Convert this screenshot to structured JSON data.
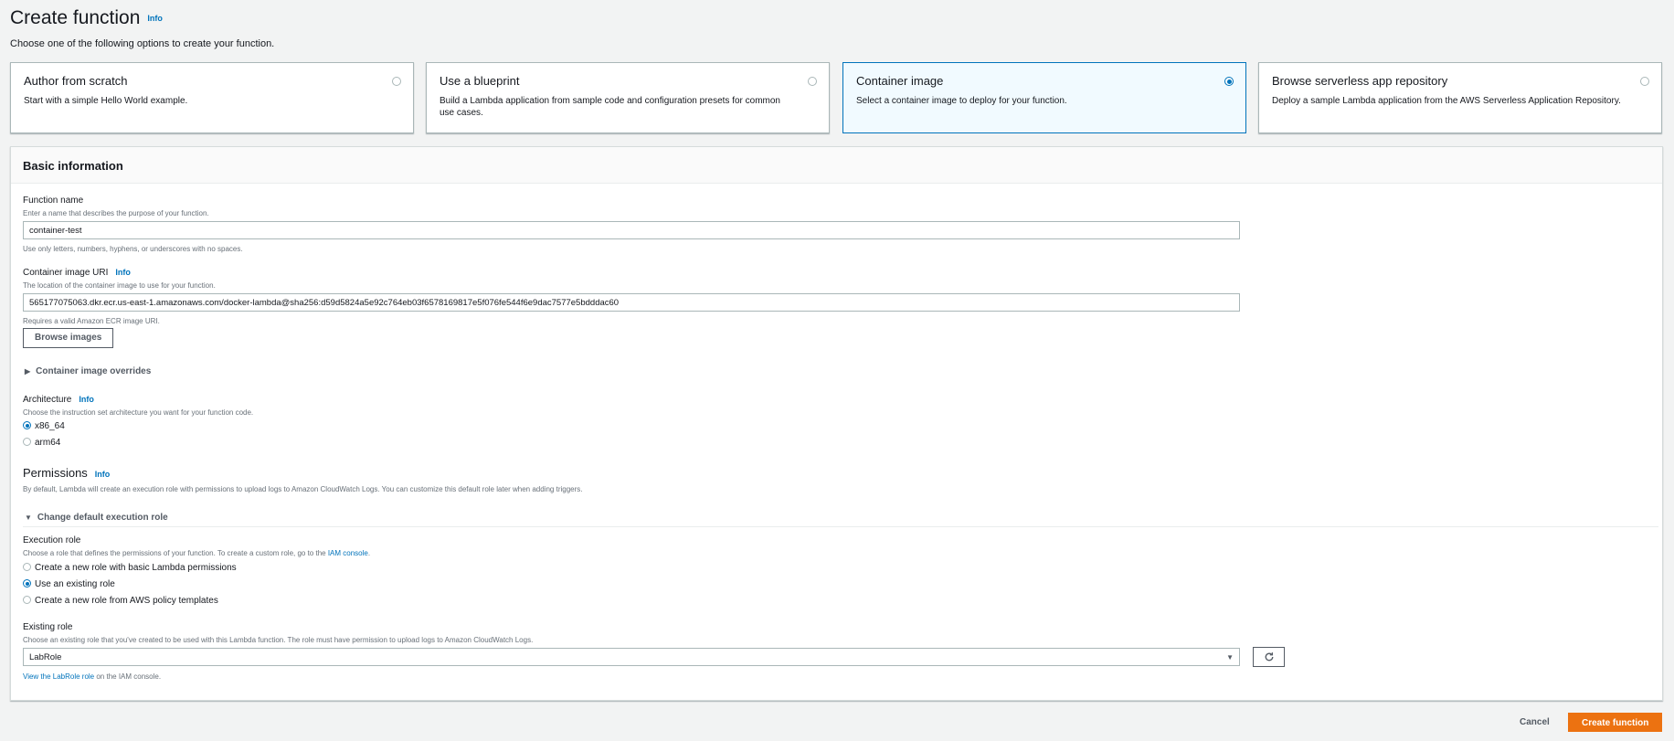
{
  "header": {
    "title": "Create function",
    "info": "Info",
    "description": "Choose one of the following options to create your function."
  },
  "options": [
    {
      "title": "Author from scratch",
      "description": "Start with a simple Hello World example.",
      "selected": false
    },
    {
      "title": "Use a blueprint",
      "description": "Build a Lambda application from sample code and configuration presets for common use cases.",
      "selected": false
    },
    {
      "title": "Container image",
      "description": "Select a container image to deploy for your function.",
      "selected": true
    },
    {
      "title": "Browse serverless app repository",
      "description": "Deploy a sample Lambda application from the AWS Serverless Application Repository.",
      "selected": false
    }
  ],
  "basic": {
    "title": "Basic information",
    "function_name": {
      "label": "Function name",
      "description": "Enter a name that describes the purpose of your function.",
      "value": "container-test",
      "constraint": "Use only letters, numbers, hyphens, or underscores with no spaces."
    },
    "image_uri": {
      "label": "Container image URI",
      "info": "Info",
      "description": "The location of the container image to use for your function.",
      "value": "565177075063.dkr.ecr.us-east-1.amazonaws.com/docker-lambda@sha256:d59d5824a5e92c764eb03f6578169817e5f076fe544f6e9dac7577e5bdddac60",
      "constraint": "Requires a valid Amazon ECR image URI.",
      "browse_label": "Browse images"
    },
    "overrides_label": "Container image overrides",
    "architecture": {
      "label": "Architecture",
      "info": "Info",
      "description": "Choose the instruction set architecture you want for your function code.",
      "options": [
        "x86_64",
        "arm64"
      ],
      "selected": "x86_64"
    },
    "permissions": {
      "title": "Permissions",
      "info": "Info",
      "description": "By default, Lambda will create an execution role with permissions to upload logs to Amazon CloudWatch Logs. You can customize this default role later when adding triggers.",
      "expander_label": "Change default execution role"
    },
    "execution_role": {
      "label": "Execution role",
      "description_prefix": "Choose a role that defines the permissions of your function. To create a custom role, go to the ",
      "description_link": "IAM console",
      "description_suffix": ".",
      "options": [
        "Create a new role with basic Lambda permissions",
        "Use an existing role",
        "Create a new role from AWS policy templates"
      ],
      "selected": "Use an existing role"
    },
    "existing_role": {
      "label": "Existing role",
      "description": "Choose an existing role that you've created to be used with this Lambda function. The role must have permission to upload logs to Amazon CloudWatch Logs.",
      "value": "LabRole",
      "view_link": "View the LabRole role",
      "view_suffix": " on the IAM console."
    }
  },
  "footer": {
    "cancel": "Cancel",
    "create": "Create function"
  },
  "colors": {
    "accent": "#0073bb",
    "primary_button": "#ec7211"
  },
  "icons": {
    "refresh": "refresh-icon",
    "caret_right": "caret-right-icon",
    "caret_down": "caret-down-icon"
  }
}
